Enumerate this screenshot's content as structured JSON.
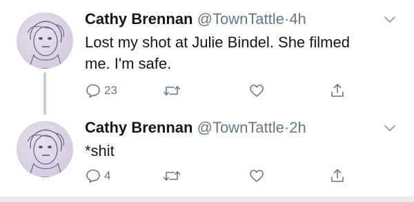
{
  "tweets": [
    {
      "author_name": "Cathy Brennan",
      "handle": "@TownTattle",
      "separator": "·",
      "time": "4h",
      "text_line_1": "Lost my shot at Julie Bindel. She filmed",
      "text_line_2": "me. I'm safe.",
      "reply_count": "23",
      "retweet_count": "",
      "like_count": ""
    },
    {
      "author_name": "Cathy Brennan",
      "handle": "@TownTattle",
      "separator": "·",
      "time": "2h",
      "text_line_1": "*shit",
      "text_line_2": "",
      "reply_count": "4",
      "retweet_count": "",
      "like_count": ""
    }
  ],
  "icons": {
    "reply": "reply-icon",
    "retweet": "retweet-icon",
    "like": "heart-icon",
    "share": "share-icon",
    "menu": "chevron-down-icon"
  },
  "colors": {
    "text": "#14171a",
    "secondary": "#657786",
    "thread_line": "#c4cfd6",
    "avatar_bg": "#d9cfe3"
  }
}
